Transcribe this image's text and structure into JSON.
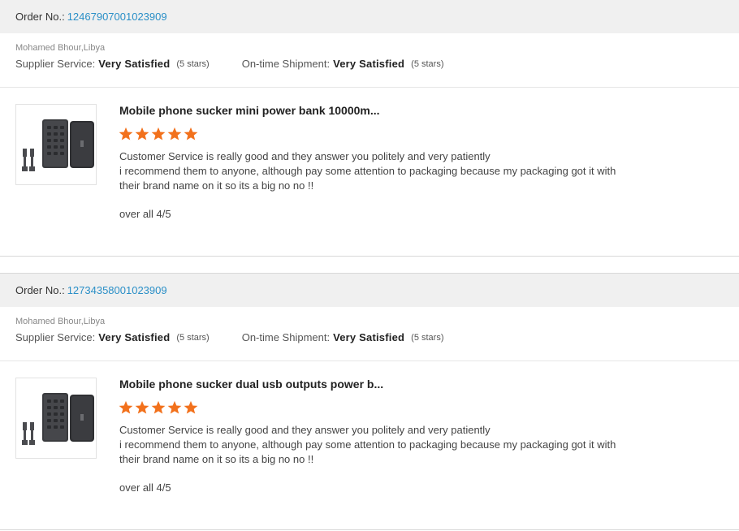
{
  "reviews": [
    {
      "order_label": "Order No.:",
      "order_number": "12467907001023909",
      "buyer": "Mohamed Bhour,Libya",
      "supplier_service_label": "Supplier Service:",
      "supplier_service_value": "Very Satisfied",
      "supplier_service_stars": "(5 stars)",
      "shipment_label": "On-time Shipment:",
      "shipment_value": "Very Satisfied",
      "shipment_stars": "(5 stars)",
      "product_title": "Mobile phone sucker mini power bank 10000m...",
      "product_rating": 5,
      "comment_lines": [
        "Customer Service is really good and they answer you politely and very patiently",
        "i recommend them to anyone, although pay some attention to packaging because my packaging got it with",
        "their brand name on it so its a big no no !!"
      ],
      "overall": "over all 4/5"
    },
    {
      "order_label": "Order No.:",
      "order_number": "12734358001023909",
      "buyer": "Mohamed Bhour,Libya",
      "supplier_service_label": "Supplier Service:",
      "supplier_service_value": "Very Satisfied",
      "supplier_service_stars": "(5 stars)",
      "shipment_label": "On-time Shipment:",
      "shipment_value": "Very Satisfied",
      "shipment_stars": "(5 stars)",
      "product_title": "Mobile phone sucker dual usb outputs power b...",
      "product_rating": 5,
      "comment_lines": [
        "Customer Service is really good and they answer you politely and very patiently",
        "i recommend them to anyone, although pay some attention to packaging because my packaging got it with",
        "their brand name on it so its a big no no !!"
      ],
      "overall": "over all 4/5"
    }
  ],
  "colors": {
    "star": "#f2711c",
    "order_link": "#2a8fc7",
    "order_bar_bg": "#f0f0f0"
  },
  "icons": {
    "star": "star-icon",
    "product_image": "power-bank-product-image"
  }
}
